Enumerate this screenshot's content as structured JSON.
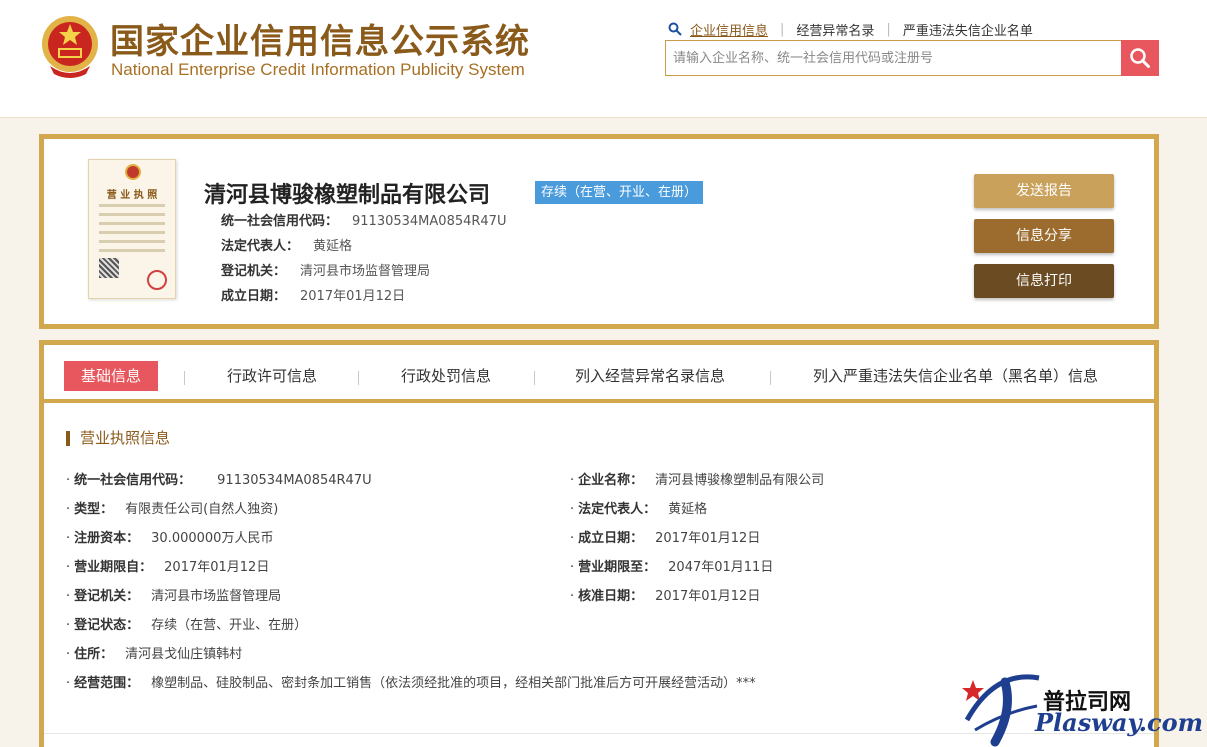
{
  "header": {
    "title_cn": "国家企业信用信息公示系统",
    "title_en": "National Enterprise Credit Information Publicity System",
    "links": [
      "企业信用信息",
      "经营异常名录",
      "严重违法失信企业名单"
    ],
    "search_placeholder": "请输入企业名称、统一社会信用代码或注册号"
  },
  "company": {
    "name": "清河县博骏橡塑制品有限公司",
    "status": "存续（在营、开业、在册）",
    "license_title": "营 业 执 照",
    "credit_code_label": "统一社会信用代码：",
    "credit_code": "91130534MA0854R47U",
    "rep_label": "法定代表人：",
    "rep": "黄延格",
    "authority_label": "登记机关：",
    "authority": "清河县市场监督管理局",
    "date_label": "成立日期：",
    "date": "2017年01月12日"
  },
  "actions": [
    "发送报告",
    "信息分享",
    "信息打印"
  ],
  "tabs": [
    "基础信息",
    "行政许可信息",
    "行政处罚信息",
    "列入经营异常名录信息",
    "列入严重违法失信企业名单（黑名单）信息"
  ],
  "section": {
    "title": "营业执照信息",
    "bullet": "·",
    "fields": {
      "credit_code": {
        "k": "统一社会信用代码：",
        "v": "91130534MA0854R47U"
      },
      "company_name": {
        "k": "企业名称：",
        "v": "清河县博骏橡塑制品有限公司"
      },
      "type": {
        "k": "类型：",
        "v": "有限责任公司(自然人独资)"
      },
      "rep": {
        "k": "法定代表人：",
        "v": "黄延格"
      },
      "capital": {
        "k": "注册资本：",
        "v": "30.000000万人民币"
      },
      "established": {
        "k": "成立日期：",
        "v": "2017年01月12日"
      },
      "term_from": {
        "k": "营业期限自：",
        "v": "2017年01月12日"
      },
      "term_to": {
        "k": "营业期限至：",
        "v": "2047年01月11日"
      },
      "authority": {
        "k": "登记机关：",
        "v": "清河县市场监督管理局"
      },
      "approved": {
        "k": "核准日期：",
        "v": "2017年01月12日"
      },
      "reg_status": {
        "k": "登记状态：",
        "v": "存续（在营、开业、在册）"
      },
      "address": {
        "k": "住所：",
        "v": "清河县戈仙庄镇韩村"
      },
      "scope": {
        "k": "经营范围：",
        "v": "橡塑制品、硅胶制品、密封条加工销售（依法须经批准的项目，经相关部门批准后方可开展经营活动）***"
      }
    }
  },
  "watermark": {
    "cn": "普拉司网",
    "en": "Plasway.com"
  },
  "colors": {
    "gold": "#d1a84e",
    "brown": "#8a5a1a",
    "accent_red": "#e8565e",
    "status_blue": "#4a9bdc"
  }
}
